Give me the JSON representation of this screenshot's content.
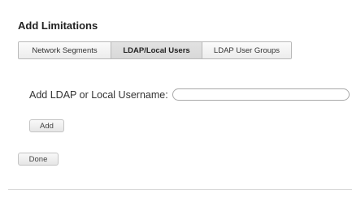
{
  "heading": "Add Limitations",
  "tabs": [
    {
      "label": "Network Segments",
      "active": false
    },
    {
      "label": "LDAP/Local Users",
      "active": true
    },
    {
      "label": "LDAP User Groups",
      "active": false
    }
  ],
  "username_field": {
    "label": "Add LDAP or Local Username:",
    "value": "",
    "placeholder": ""
  },
  "buttons": {
    "add": "Add",
    "done": "Done"
  }
}
